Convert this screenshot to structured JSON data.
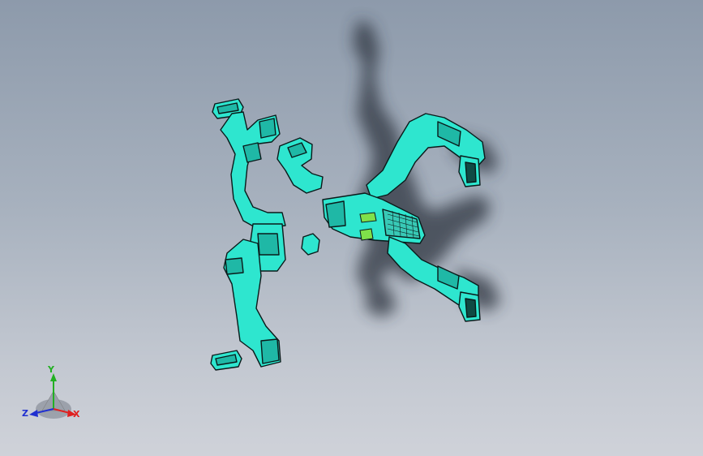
{
  "viewport": {
    "colors": {
      "background_top": "#8d9aab",
      "background_bottom": "#cfd2d9",
      "part_fill": "#2ee6cf",
      "part_edge": "#0a1a1a",
      "highlight": "#7fe04a",
      "shadow": "#2e3440"
    }
  },
  "triad": {
    "y_label": "Y",
    "z_label": "Z",
    "x_label": "X",
    "colors": {
      "x": "#e02020",
      "y": "#22b022",
      "z": "#2030d0"
    }
  }
}
